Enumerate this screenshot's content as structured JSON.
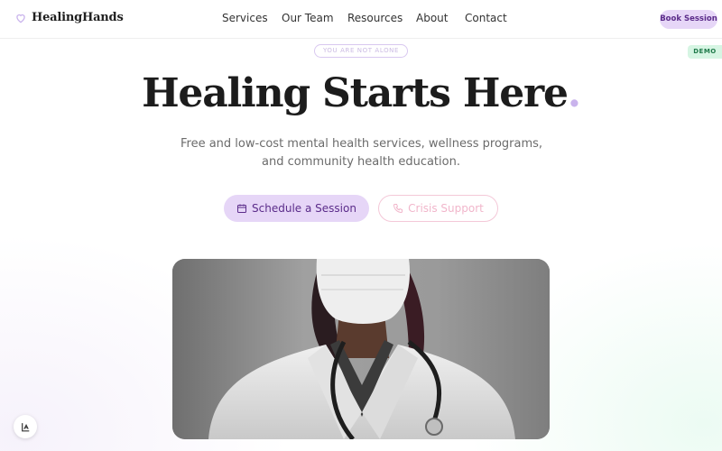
{
  "brand": {
    "name": "HealingHands",
    "icon": "heart-icon",
    "accent": "#c9b3ec"
  },
  "nav": {
    "links": [
      "Services",
      "Our Team",
      "Resources",
      "About",
      "Contact"
    ],
    "cta": "Book Session"
  },
  "badge": "DEMO",
  "hero": {
    "eyebrow": "YOU ARE NOT ALONE",
    "headline": "Healing Starts Here",
    "headline_dot": ".",
    "subtitle_line1": "Free and low-cost mental health services, wellness programs,",
    "subtitle_line2": "and community health education.",
    "primary_button": {
      "label": "Schedule a Session",
      "icon": "calendar-icon"
    },
    "secondary_button": {
      "label": "Crisis Support",
      "icon": "phone-icon"
    },
    "image": "doctor-with-mask-and-stethoscope"
  },
  "floating_widget": {
    "icon": "accessibility-icon"
  },
  "colors": {
    "primary_bg": "#e6d6f7",
    "primary_text": "#5b2c8a",
    "crisis": "#f4c8d8",
    "demo_bg": "#d6f5e3"
  }
}
